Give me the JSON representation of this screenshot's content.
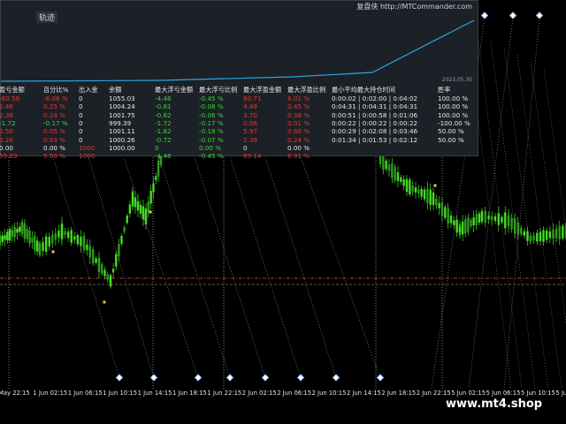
{
  "panel": {
    "title": "轨迹",
    "brand": "复盘侠 http://MTCommander.com",
    "date": "2023.05.30",
    "headers": [
      "盈亏金额",
      "百分比%",
      "出入金",
      "余额",
      "最大浮亏金额",
      "最大浮亏比例",
      "最大浮盈金额",
      "最大浮盈比例",
      "最小平均最大持仓时间",
      "胜率"
    ],
    "rows": [
      [
        "-60.59",
        "-6.06 %",
        "0",
        "1055.03",
        "-4.46",
        "-0.45 %",
        "60.71",
        "6.01 %",
        "0:00:02 | 0:02:00 | 0:04:02",
        "100.00 %"
      ],
      [
        "2.46",
        "0.25 %",
        "0",
        "1004.24",
        "-0.81",
        "-0.08 %",
        "4.49",
        "0.45 %",
        "0:04:31 | 0:04:31 | 0:04:31",
        "100.00 %"
      ],
      [
        "2.36",
        "0.24 %",
        "0",
        "1001.75",
        "-0.62",
        "-0.06 %",
        "3.70",
        "0.38 %",
        "0:00:51 | 0:00:58 | 0:01:06",
        "100.00 %"
      ],
      [
        "-1.72",
        "-0.17 %",
        "0",
        "999.39",
        "-1.72",
        "-0.17 %",
        "0.06",
        "0.01 %",
        "0:00:22 | 0:00:22 | 0:00:22",
        "-100.00 %"
      ],
      [
        "0.50",
        "0.05 %",
        "0",
        "1001.11",
        "-1.82",
        "-0.18 %",
        "5.97",
        "0.60 %",
        "0:00:29 | 0:02:08 | 0:03:46",
        "50.00 %"
      ],
      [
        "0.26",
        "0.03 %",
        "0",
        "1000.26",
        "-0.72",
        "-0.07 %",
        "2.39",
        "0.24 %",
        "0:01:34 | 0:01:53 | 0:02:12",
        "50.00 %"
      ],
      [
        "0.00",
        "0.00 %",
        "1000",
        "1000.00",
        "0",
        "0.00 %",
        "0",
        "0.00 %",
        "",
        ""
      ],
      [
        "55.03",
        "5.50 %",
        "1000",
        "",
        "-4.46",
        "-0.45 %",
        "69.14",
        "6.91 %",
        "",
        ""
      ]
    ],
    "row_colors": [
      [
        "red",
        "red",
        "white",
        "white",
        "green",
        "green",
        "red",
        "red",
        "white",
        "white"
      ],
      [
        "red",
        "red",
        "white",
        "white",
        "green",
        "green",
        "red",
        "red",
        "white",
        "white"
      ],
      [
        "red",
        "red",
        "white",
        "white",
        "green",
        "green",
        "red",
        "red",
        "white",
        "white"
      ],
      [
        "green",
        "green",
        "white",
        "white",
        "green",
        "green",
        "red",
        "red",
        "white",
        "white"
      ],
      [
        "red",
        "red",
        "white",
        "white",
        "green",
        "green",
        "red",
        "red",
        "white",
        "white"
      ],
      [
        "red",
        "red",
        "white",
        "white",
        "green",
        "green",
        "red",
        "red",
        "white",
        "white"
      ],
      [
        "white",
        "white",
        "red",
        "white",
        "green",
        "green",
        "white",
        "white",
        "white",
        "white"
      ],
      [
        "red",
        "red",
        "red",
        "white",
        "green",
        "green",
        "red",
        "red",
        "white",
        "white"
      ]
    ]
  },
  "x_labels": [
    "May 22:15",
    "1 Jun 02:15",
    "1 Jun 06:15",
    "1 Jun 10:15",
    "1 Jun 14:15",
    "1 Jun 18:15",
    "1 Jun 22:15",
    "2 Jun 02:15",
    "2 Jun 06:15",
    "2 Jun 10:15",
    "2 Jun 14:15",
    "2 Jun 18:15",
    "2 Jun 22:15",
    "5 Jun 02:15",
    "5 Jun 06:15",
    "5 Jun 10:15",
    "5 Ju"
  ],
  "watermark": "www.mt4.shop",
  "colors": {
    "background": "#000000",
    "bull": "#44dd22",
    "bear": "#2f9a1e",
    "equity_line": "#29a8e0",
    "trade_line": "#9b9b9b",
    "red_level": "#c0392b",
    "trade_marker": "#8ab4f8"
  }
}
